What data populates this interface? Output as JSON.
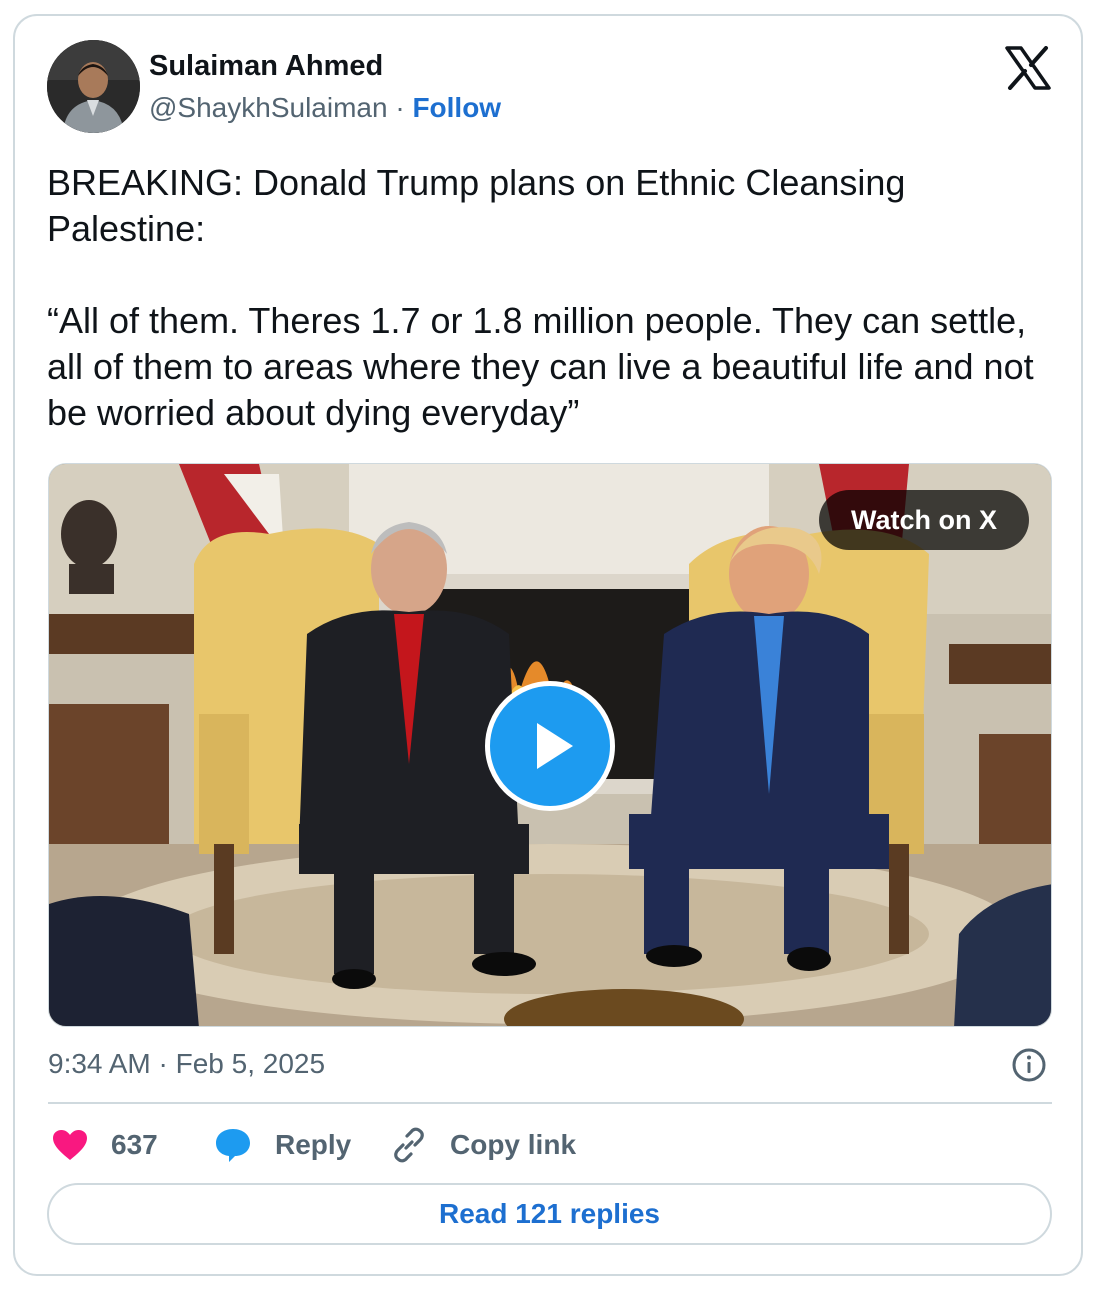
{
  "author": {
    "name": "Sulaiman Ahmed",
    "handle": "@ShaykhSulaiman",
    "separator": " · ",
    "follow_label": "Follow"
  },
  "tweet": {
    "paragraphs": [
      "BREAKING: Donald Trump plans on Ethnic Cleansing Palestine:",
      "“All of them. Theres 1.7 or 1.8 million people. They can settle, all of them to areas where they can live a beautiful life and not be worried about dying everyday”"
    ]
  },
  "media": {
    "watch_label": "Watch on X"
  },
  "meta": {
    "timestamp": "9:34 AM · Feb 5, 2025"
  },
  "actions": {
    "like_count": "637",
    "reply_label": "Reply",
    "copy_label": "Copy link",
    "read_replies_label": "Read 121 replies"
  },
  "colors": {
    "like": "#f91880",
    "reply": "#1d9bf0",
    "link": "#1d6fd0",
    "muted": "#536471",
    "border": "#cfd9de"
  },
  "icons": [
    "x-logo-icon",
    "play-icon",
    "info-icon",
    "heart-icon",
    "reply-bubble-icon",
    "link-icon"
  ]
}
